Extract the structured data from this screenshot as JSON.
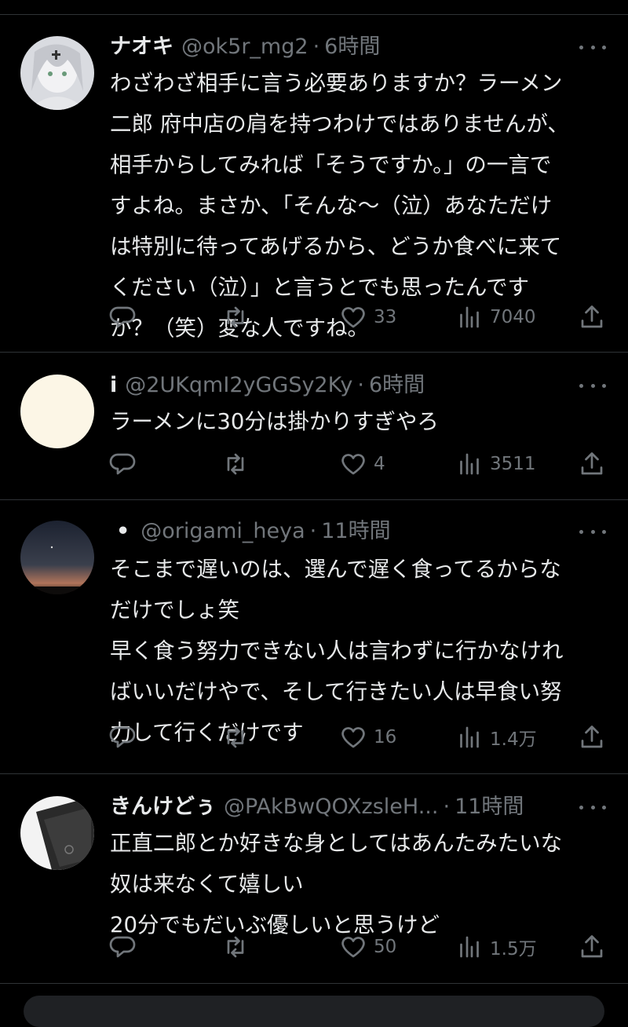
{
  "tweets": [
    {
      "name": "ナオキ",
      "handle": "@ok5r_mg2",
      "time": "6時間",
      "text": "わざわざ相手に言う必要ありますか？ラーメン\n二郎 府中店の肩を持つわけではありませんが、\n相手からしてみれば「そうですか。」の一言で\nすよね。まさか、「そんな〜（泣）あなただけ\nは特別に待ってあげるから、どうか食べに来て\nください（泣）」と言うとでも思ったんです\nか？（笑）変な人ですね。",
      "likes": "33",
      "views": "7040"
    },
    {
      "name": "i",
      "handle": "@2UKqmI2yGGSy2Ky",
      "time": "6時間",
      "text": "ラーメンに30分は掛かりすぎやろ",
      "likes": "4",
      "views": "3511"
    },
    {
      "name": "•",
      "handle": "@origami_heya",
      "time": "11時間",
      "text": "そこまで遅いのは、選んで遅く食ってるからな\nだけでしょ笑\n早く食う努力できない人は言わずに行かなけれ\nばいいだけやで、そして行きたい人は早食い努\n力して行くだけです",
      "likes": "16",
      "views": "1.4万"
    },
    {
      "name": "きんけどぅ",
      "handle": "@PAkBwQOXzsleH...",
      "time": "11時間",
      "text": "正直二郎とか好きな身としてはあんたみたいな\n奴は来なくて嬉しい\n20分でもだいぶ優しいと思うけど",
      "likes": "50",
      "views": "1.5万"
    }
  ],
  "icons": {
    "reply": "reply-icon",
    "retweet": "retweet-icon",
    "like": "heart-icon",
    "views": "views-icon",
    "share": "share-icon",
    "more": "more-icon"
  },
  "colors": {
    "background": "#000000",
    "text": "#e7e9ea",
    "muted": "#71767b",
    "divider": "#2f3336"
  }
}
